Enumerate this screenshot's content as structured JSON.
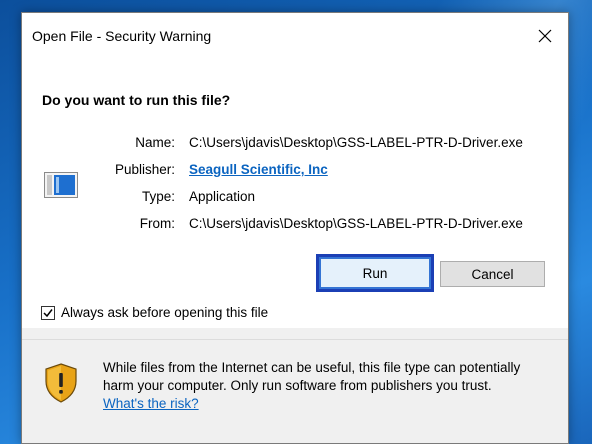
{
  "dialog": {
    "title": "Open File - Security Warning",
    "question": "Do you want to run this file?",
    "details": [
      {
        "label": "Name:",
        "value": "C:\\Users\\jdavis\\Desktop\\GSS-LABEL-PTR-D-Driver.exe"
      },
      {
        "label": "Publisher:",
        "value": "Seagull Scientific, Inc"
      },
      {
        "label": "Type:",
        "value": "Application"
      },
      {
        "label": "From:",
        "value": "C:\\Users\\jdavis\\Desktop\\GSS-LABEL-PTR-D-Driver.exe"
      }
    ],
    "run_label": "Run",
    "cancel_label": "Cancel",
    "always_ask_label": "Always ask before opening this file",
    "always_ask_checked": true,
    "warning_text": "While files from the Internet can be useful, this file type can potentially harm your computer. Only run software from publishers you trust.",
    "risk_link": "What's the risk?"
  },
  "colors": {
    "link": "#0b64c0",
    "run_highlight": "#1b3fb5",
    "shield": "#e8a317"
  },
  "icons": {
    "close": "close-icon",
    "file": "application-file-icon",
    "shield": "security-shield-icon",
    "check": "checkmark-icon"
  }
}
